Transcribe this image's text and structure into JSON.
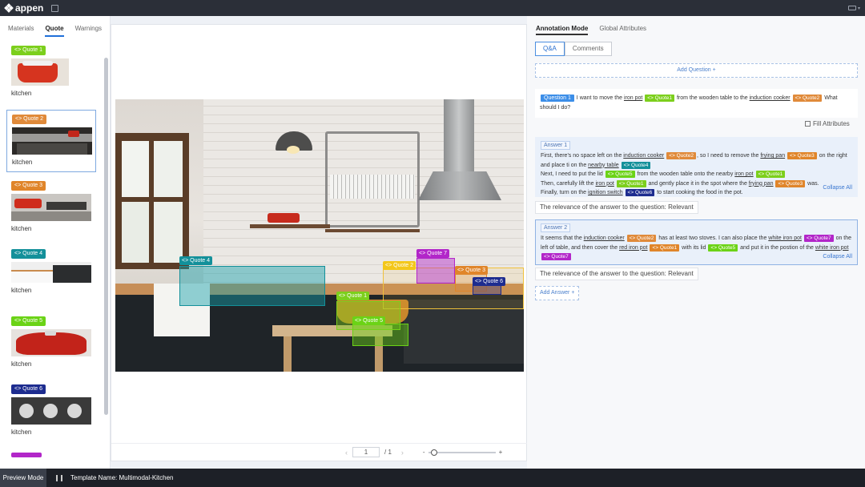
{
  "app": {
    "name": "appen"
  },
  "colors": {
    "q1": "#7ccf1c",
    "q2": "#e08a3a",
    "q3": "#e0852a",
    "q4": "#13909a",
    "q5": "#6bd316",
    "q6": "#1d2c8f",
    "q7": "#b226c9",
    "question": "#3c8ee8"
  },
  "left_tabs": [
    "Materials",
    "Quote",
    "Warnings"
  ],
  "quotes": [
    {
      "tag": "<> Quote 1",
      "label": "kitchen",
      "color": "#7ccf1c"
    },
    {
      "tag": "<> Quote 2",
      "label": "kitchen",
      "color": "#e08a3a"
    },
    {
      "tag": "<> Quote 3",
      "label": "kitchen",
      "color": "#e0852a"
    },
    {
      "tag": "<> Quote 4",
      "label": "kitchen",
      "color": "#13909a"
    },
    {
      "tag": "<> Quote 5",
      "label": "kitchen",
      "color": "#6bd316"
    },
    {
      "tag": "<> Quote 6",
      "label": "kitchen",
      "color": "#1d2c8f"
    }
  ],
  "image_tags": {
    "q1": "<> Quote 1",
    "q2": "<> Quote 2",
    "q3": "<> Quote 3",
    "q4": "<> Quote 4",
    "q5": "<> Quote 5",
    "q6": "<> Quote 6",
    "q7": "<> Quote 7"
  },
  "pager": {
    "prev": "‹",
    "next": "›",
    "page": "1",
    "total": "/ 1",
    "zoom_minus": "-",
    "zoom_plus": "+",
    "zoom_level": 0.05
  },
  "right_tabs": [
    "Annotation Mode",
    "Global Attributes"
  ],
  "segments": [
    "Q&A",
    "Comments"
  ],
  "add_question": "Add Question",
  "question": {
    "label": "Question 1",
    "t1": " I want to move the ",
    "iron_pot": "iron pot",
    "tag_q1": "<> Quote1",
    "t2": " from the wooden table to the ",
    "induction_cooker": "induction cooker",
    "tag_q2": "<> Quote2",
    "t3": " What should I do?"
  },
  "fill_attributes": "Fill Attributes",
  "answer1": {
    "label": "Answer 1",
    "l1a": "First, there's no space left on the ",
    "induction_cooker": "induction cooker",
    "tag_q2": "<> Quote2",
    "l1b": ", so I need to remove the ",
    "frying_pan": "frying pan",
    "tag_q3": "<> Quote3",
    "l1c": " on the right and place ti on the ",
    "nearby_table": "nearby table",
    "tag_q4": "<> Quote4",
    "l2a": "Next, I need to put the lid ",
    "tag_q5": "<> Quote5",
    "l2b": " from the wooden table onto the nearby ",
    "iron_pot": "iron pot",
    "tag_q1": "<> Quote1",
    "l3a": "Then, carefully lift the ",
    "iron_pot2": "iron pot",
    "tag_q1b": "<> Quote1",
    "l3b": " and gently place it in the spot where the ",
    "frying_pan2": "frying pan",
    "tag_q3b": "<> Quote3",
    "l3c": " was.",
    "l4a": "Finally, turn on the ",
    "ignition_switch": "ignition switch",
    "tag_q6": "<> Quote6",
    "l4b": " to start cooking the food in the pot.",
    "collapse": "Collapse All"
  },
  "relevance1": "The relevance of the answer to the question: Relevant",
  "answer2": {
    "label": "Answer 2",
    "l1a": "It seems that the ",
    "induction_cooker": "induction cooker",
    "tag_q2": "<> Quote2",
    "l1b": " has at least two stoves. I can also place the ",
    "white_iron_pot": "white iron pot",
    "tag_q7": "<> Quote7",
    "l1c": " on the left of table, and then cover the ",
    "red_iron_pot": "red iron pot",
    "tag_q1": "<> Quote1",
    "l1d": " with its lid ",
    "tag_q5": "<> Quote5",
    "l1e": " and put it in the postion of the ",
    "white_iron_pot2": "white iron pot",
    "tag_q7b": "<> Quote7",
    "collapse": "Collapse All"
  },
  "relevance2": "The relevance of the answer to the question: Relevant",
  "add_answer": "Add Answer",
  "bottom": {
    "preview": "Preview Mode",
    "template": "Template Name: Multimodal-Kitchen"
  }
}
